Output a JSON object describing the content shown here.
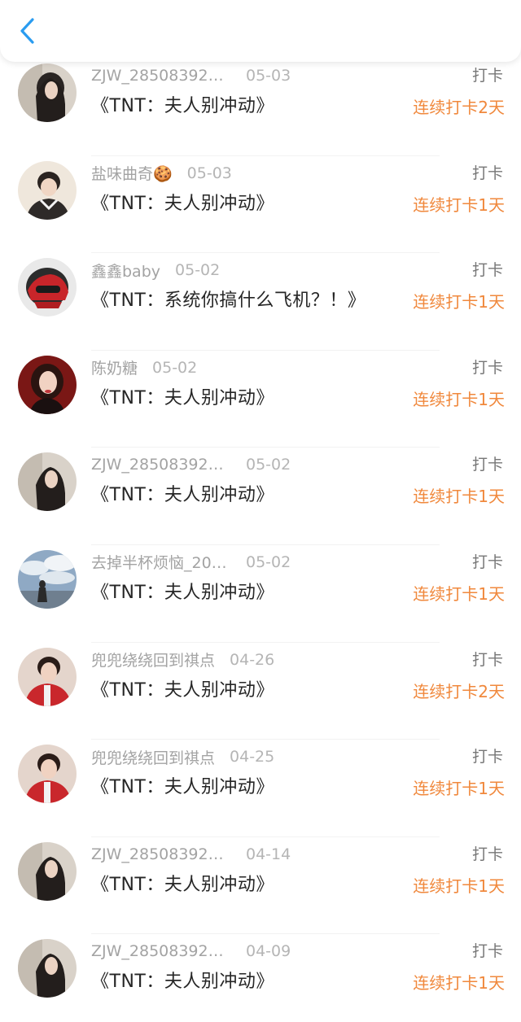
{
  "header": {
    "back_icon": "chevron-left-icon",
    "accent": "#2a9cf0"
  },
  "colors": {
    "streak": "#f0883c",
    "meta": "#a3a3a3",
    "title": "#262626"
  },
  "rows": [
    {
      "user": "ZJW_28508392…",
      "date": "05-03",
      "book": "《TNT：夫人别冲动》",
      "action": "打卡",
      "streak": "连续打卡2天",
      "avatar": "avatar-woman-dark-hair"
    },
    {
      "user": "盐味曲奇🍪",
      "date": "05-03",
      "book": "《TNT：夫人别冲动》",
      "action": "打卡",
      "streak": "连续打卡1天",
      "avatar": "avatar-young-man"
    },
    {
      "user": "鑫鑫baby",
      "date": "05-02",
      "book": "《TNT：系统你搞什么飞机？！》",
      "action": "打卡",
      "streak": "连续打卡1天",
      "avatar": "avatar-red-helmet"
    },
    {
      "user": "陈奶糖",
      "date": "05-02",
      "book": "《TNT：夫人别冲动》",
      "action": "打卡",
      "streak": "连续打卡1天",
      "avatar": "avatar-woman-red"
    },
    {
      "user": "ZJW_28508392…",
      "date": "05-02",
      "book": "《TNT：夫人别冲动》",
      "action": "打卡",
      "streak": "连续打卡1天",
      "avatar": "avatar-woman-dark-hair"
    },
    {
      "user": "去掉半杯烦恼_20…",
      "date": "05-02",
      "book": "《TNT：夫人别冲动》",
      "action": "打卡",
      "streak": "连续打卡1天",
      "avatar": "avatar-sky-clouds"
    },
    {
      "user": "兜兜绕绕回到祺点",
      "date": "04-26",
      "book": "《TNT：夫人别冲动》",
      "action": "打卡",
      "streak": "连续打卡2天",
      "avatar": "avatar-man-red-jacket"
    },
    {
      "user": "兜兜绕绕回到祺点",
      "date": "04-25",
      "book": "《TNT：夫人别冲动》",
      "action": "打卡",
      "streak": "连续打卡1天",
      "avatar": "avatar-man-red-jacket"
    },
    {
      "user": "ZJW_28508392…",
      "date": "04-14",
      "book": "《TNT：夫人别冲动》",
      "action": "打卡",
      "streak": "连续打卡1天",
      "avatar": "avatar-woman-dark-hair"
    },
    {
      "user": "ZJW_28508392…",
      "date": "04-09",
      "book": "《TNT：夫人别冲动》",
      "action": "打卡",
      "streak": "连续打卡1天",
      "avatar": "avatar-woman-dark-hair"
    }
  ]
}
